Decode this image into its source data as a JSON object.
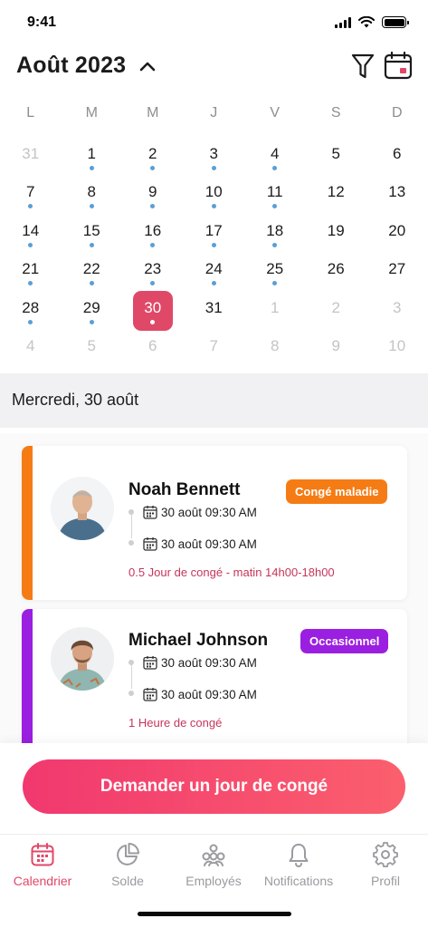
{
  "status_bar": {
    "time": "9:41"
  },
  "header": {
    "month_title": "Août 2023"
  },
  "calendar": {
    "weekdays": [
      "L",
      "M",
      "M",
      "J",
      "V",
      "S",
      "D"
    ],
    "weeks": [
      [
        {
          "n": "31",
          "m": true,
          "dot": false
        },
        {
          "n": "1",
          "m": false,
          "dot": true
        },
        {
          "n": "2",
          "m": false,
          "dot": true
        },
        {
          "n": "3",
          "m": false,
          "dot": true
        },
        {
          "n": "4",
          "m": false,
          "dot": true
        },
        {
          "n": "5",
          "m": false,
          "dot": false
        },
        {
          "n": "6",
          "m": false,
          "dot": false
        }
      ],
      [
        {
          "n": "7",
          "m": false,
          "dot": true
        },
        {
          "n": "8",
          "m": false,
          "dot": true
        },
        {
          "n": "9",
          "m": false,
          "dot": true
        },
        {
          "n": "10",
          "m": false,
          "dot": true
        },
        {
          "n": "11",
          "m": false,
          "dot": true
        },
        {
          "n": "12",
          "m": false,
          "dot": false
        },
        {
          "n": "13",
          "m": false,
          "dot": false
        }
      ],
      [
        {
          "n": "14",
          "m": false,
          "dot": true
        },
        {
          "n": "15",
          "m": false,
          "dot": true
        },
        {
          "n": "16",
          "m": false,
          "dot": true
        },
        {
          "n": "17",
          "m": false,
          "dot": true
        },
        {
          "n": "18",
          "m": false,
          "dot": true
        },
        {
          "n": "19",
          "m": false,
          "dot": false
        },
        {
          "n": "20",
          "m": false,
          "dot": false
        }
      ],
      [
        {
          "n": "21",
          "m": false,
          "dot": true
        },
        {
          "n": "22",
          "m": false,
          "dot": true
        },
        {
          "n": "23",
          "m": false,
          "dot": true
        },
        {
          "n": "24",
          "m": false,
          "dot": true
        },
        {
          "n": "25",
          "m": false,
          "dot": true
        },
        {
          "n": "26",
          "m": false,
          "dot": false
        },
        {
          "n": "27",
          "m": false,
          "dot": false
        }
      ],
      [
        {
          "n": "28",
          "m": false,
          "dot": true
        },
        {
          "n": "29",
          "m": false,
          "dot": true
        },
        {
          "n": "30",
          "m": false,
          "dot": true,
          "selected": true
        },
        {
          "n": "31",
          "m": false,
          "dot": false
        },
        {
          "n": "1",
          "m": true,
          "dot": false
        },
        {
          "n": "2",
          "m": true,
          "dot": false
        },
        {
          "n": "3",
          "m": true,
          "dot": false
        }
      ],
      [
        {
          "n": "4",
          "m": true,
          "dot": false
        },
        {
          "n": "5",
          "m": true,
          "dot": false
        },
        {
          "n": "6",
          "m": true,
          "dot": false
        },
        {
          "n": "7",
          "m": true,
          "dot": false
        },
        {
          "n": "8",
          "m": true,
          "dot": false
        },
        {
          "n": "9",
          "m": true,
          "dot": false
        },
        {
          "n": "10",
          "m": true,
          "dot": false
        }
      ]
    ],
    "colors": {
      "selected": "#e04868",
      "event_dot": "#5a9fd6"
    }
  },
  "selected_date_label": "Mercredi, 30 août",
  "leaves": [
    {
      "name": "Noah Bennett",
      "badge": "Congé maladie",
      "badge_color": "#f57c14",
      "accent_color": "#f57c14",
      "start": "30 août 09:30 AM",
      "end": "30 août 09:30 AM",
      "note": "0.5 Jour de congé - matin 14h00-18h00"
    },
    {
      "name": "Michael Johnson",
      "badge": "Occasionnel",
      "badge_color": "#9b1fe0",
      "accent_color": "#9b1fe0",
      "start": "30 août 09:30 AM",
      "end": "30 août 09:30 AM",
      "note": "1 Heure de congé"
    }
  ],
  "cta": {
    "label": "Demander un jour de congé"
  },
  "tabs": [
    {
      "label": "Calendrier",
      "icon": "calendar-icon",
      "active": true
    },
    {
      "label": "Solde",
      "icon": "pie-chart-icon",
      "active": false
    },
    {
      "label": "Employés",
      "icon": "team-icon",
      "active": false
    },
    {
      "label": "Notifications",
      "icon": "bell-icon",
      "active": false
    },
    {
      "label": "Profil",
      "icon": "gear-icon",
      "active": false
    }
  ]
}
